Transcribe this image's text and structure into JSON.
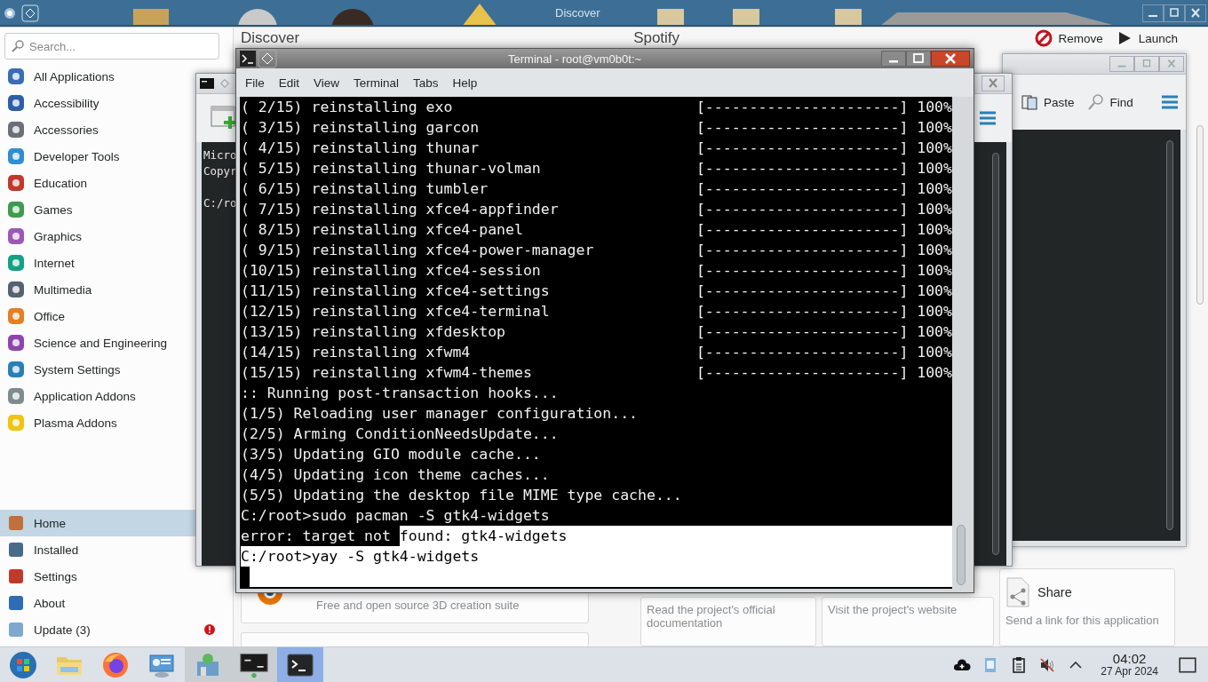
{
  "discover": {
    "title": "Discover",
    "search": {
      "placeholder": "Search..."
    },
    "categories": [
      "All Applications",
      "Accessibility",
      "Accessories",
      "Developer Tools",
      "Education",
      "Games",
      "Graphics",
      "Internet",
      "Multimedia",
      "Office",
      "Science and Engineering",
      "System Settings",
      "Application Addons",
      "Plasma Addons"
    ],
    "nav": [
      {
        "label": "Home",
        "selected": true
      },
      {
        "label": "Installed",
        "selected": false
      },
      {
        "label": "Settings",
        "selected": false
      },
      {
        "label": "About",
        "selected": false
      },
      {
        "label": "Update (3)",
        "selected": false,
        "alert": true
      }
    ],
    "page_title": "Discover",
    "app_title": "Spotify",
    "actions": [
      {
        "kind": "remove",
        "label": "Remove"
      },
      {
        "kind": "launch",
        "label": "Launch"
      }
    ],
    "app_card": {
      "description": "Free and open source 3D creation suite"
    },
    "link_cards": [
      {
        "kind": "docs",
        "description": "Read the project's official documentation"
      },
      {
        "kind": "website",
        "description": "Visit the project's website"
      },
      {
        "kind": "share",
        "title": "Share",
        "description": "Send a link for this application"
      }
    ]
  },
  "background_terminal": {
    "blocks": [
      {
        "lines": [
          "Micro",
          "Copyr"
        ]
      },
      {
        "lines": [
          "C:/ro"
        ]
      }
    ]
  },
  "file_window": {
    "toolbar": [
      {
        "kind": "paste",
        "label": "Paste"
      },
      {
        "kind": "find",
        "label": "Find"
      }
    ]
  },
  "terminal": {
    "title": "Terminal - root@vm0b0t:~",
    "menu": [
      "File",
      "Edit",
      "View",
      "Terminal",
      "Tabs",
      "Help"
    ],
    "lines": [
      {
        "text": "( 2/15) reinstalling exo",
        "bar": "[----------------------] 100%",
        "selected": false
      },
      {
        "text": "( 3/15) reinstalling garcon",
        "bar": "[----------------------] 100%",
        "selected": false
      },
      {
        "text": "( 4/15) reinstalling thunar",
        "bar": "[----------------------] 100%",
        "selected": false
      },
      {
        "text": "( 5/15) reinstalling thunar-volman",
        "bar": "[----------------------] 100%",
        "selected": false
      },
      {
        "text": "( 6/15) reinstalling tumbler",
        "bar": "[----------------------] 100%",
        "selected": false
      },
      {
        "text": "( 7/15) reinstalling xfce4-appfinder",
        "bar": "[----------------------] 100%",
        "selected": false
      },
      {
        "text": "( 8/15) reinstalling xfce4-panel",
        "bar": "[----------------------] 100%",
        "selected": false
      },
      {
        "text": "( 9/15) reinstalling xfce4-power-manager",
        "bar": "[----------------------] 100%",
        "selected": false
      },
      {
        "text": "(10/15) reinstalling xfce4-session",
        "bar": "[----------------------] 100%",
        "selected": false
      },
      {
        "text": "(11/15) reinstalling xfce4-settings",
        "bar": "[----------------------] 100%",
        "selected": false
      },
      {
        "text": "(12/15) reinstalling xfce4-terminal",
        "bar": "[----------------------] 100%",
        "selected": false
      },
      {
        "text": "(13/15) reinstalling xfdesktop",
        "bar": "[----------------------] 100%",
        "selected": false
      },
      {
        "text": "(14/15) reinstalling xfwm4",
        "bar": "[----------------------] 100%",
        "selected": false
      },
      {
        "text": "(15/15) reinstalling xfwm4-themes",
        "bar": "[----------------------] 100%",
        "selected": false
      },
      {
        "text": ":: Running post-transaction hooks...",
        "selected": false
      },
      {
        "text": "(1/5) Reloading user manager configuration...",
        "selected": false
      },
      {
        "text": "(2/5) Arming ConditionNeedsUpdate...",
        "selected": false
      },
      {
        "text": "(3/5) Updating GIO module cache...",
        "selected": false
      },
      {
        "text": "(4/5) Updating icon theme caches...",
        "selected": false
      },
      {
        "text": "(5/5) Updating the desktop file MIME type cache...",
        "selected": false
      },
      {
        "text": "C:/root>sudo pacman -S gtk4-widgets",
        "selected": false
      },
      {
        "parts": [
          {
            "text": "error: target not ",
            "selected": false
          },
          {
            "text": "found: gtk4-widgets",
            "selected": true
          }
        ]
      },
      {
        "text": "C:/root>yay -S gtk4-widgets",
        "selected": true
      }
    ],
    "cursor": {
      "selected": true
    }
  },
  "taskbar": {
    "tasks": [
      {
        "kind": "start",
        "running": false,
        "selected": false
      },
      {
        "kind": "files",
        "running": false,
        "selected": false
      },
      {
        "kind": "browser",
        "running": false,
        "selected": false
      },
      {
        "kind": "settings",
        "running": false,
        "selected": false
      },
      {
        "kind": "discover",
        "running": true,
        "selected": false
      },
      {
        "kind": "old-terminal",
        "running": true,
        "selected": false
      },
      {
        "kind": "terminal",
        "running": true,
        "selected": true
      }
    ],
    "time": "04:02",
    "date": "27 Apr 2024"
  }
}
